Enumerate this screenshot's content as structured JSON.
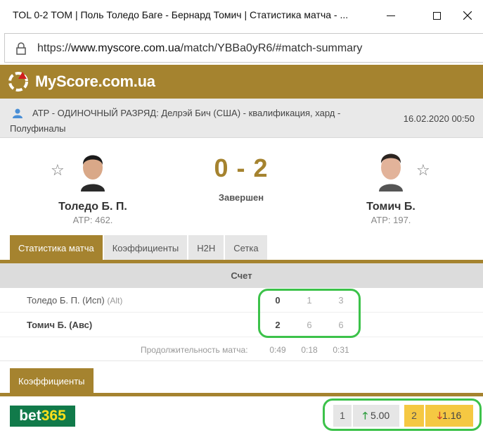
{
  "window": {
    "title": "TOL 0-2 TOM | Поль Толедо Баге - Бернард Томич | Статистика матча - ..."
  },
  "address": {
    "protocol": "https://",
    "host": "www.myscore.com.ua",
    "path": "/match/YBBa0yR6/#match-summary"
  },
  "site": {
    "logo_text": "MyScore.com.ua"
  },
  "tournament": {
    "text": "ATP - ОДИНОЧНЫЙ РАЗРЯД: Делрэй Бич (США) - квалификация, хард - Полуфиналы",
    "datetime": "16.02.2020 00:50"
  },
  "match": {
    "home": {
      "name": "Толедо Б. П.",
      "rank": "ATP: 462."
    },
    "away": {
      "name": "Томич Б.",
      "rank": "ATP: 197."
    },
    "score": "0 - 2",
    "status": "Завершен"
  },
  "tabs": [
    {
      "label": "Статистика матча",
      "active": true
    },
    {
      "label": "Коэффициенты",
      "active": false
    },
    {
      "label": "H2H",
      "active": false
    },
    {
      "label": "Сетка",
      "active": false
    }
  ],
  "score_table": {
    "header": "Счет",
    "rows": [
      {
        "name": "Толедо Б. П. (Исп)",
        "tag": "(Alt)",
        "total": "0",
        "sets": [
          "1",
          "3"
        ]
      },
      {
        "name": "Томич Б. (Авс)",
        "tag": "",
        "total": "2",
        "sets": [
          "6",
          "6"
        ]
      }
    ],
    "duration_label": "Продолжительность матча:",
    "durations": [
      "0:49",
      "0:18",
      "0:31"
    ]
  },
  "odds": {
    "tab_label": "Коэффициенты",
    "bookmaker": {
      "part1": "bet",
      "part2": "365"
    },
    "home_label": "1",
    "home_value": "5.00",
    "away_label": "2",
    "away_value": "1.16",
    "up_arrow": "🡑",
    "down_arrow": "🡓"
  },
  "colors": {
    "brand": "#a5832f",
    "highlight": "#3cc24a",
    "bet365": "#117a4a",
    "odd_fav": "#f5c842"
  }
}
